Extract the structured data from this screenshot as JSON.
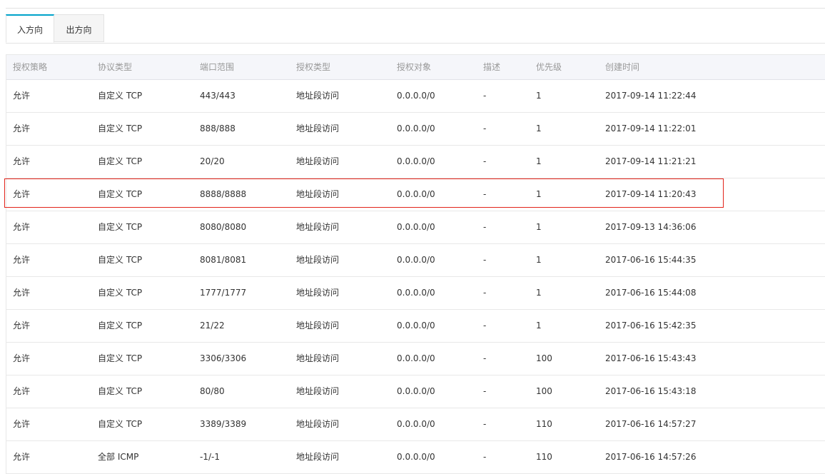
{
  "tabs": [
    {
      "label": "入方向",
      "active": true
    },
    {
      "label": "出方向",
      "active": false
    }
  ],
  "table": {
    "columns": [
      "授权策略",
      "协议类型",
      "端口范围",
      "授权类型",
      "授权对象",
      "描述",
      "优先级",
      "创建时间"
    ],
    "rows": [
      [
        "允许",
        "自定义 TCP",
        "443/443",
        "地址段访问",
        "0.0.0.0/0",
        "-",
        "1",
        "2017-09-14 11:22:44"
      ],
      [
        "允许",
        "自定义 TCP",
        "888/888",
        "地址段访问",
        "0.0.0.0/0",
        "-",
        "1",
        "2017-09-14 11:22:01"
      ],
      [
        "允许",
        "自定义 TCP",
        "20/20",
        "地址段访问",
        "0.0.0.0/0",
        "-",
        "1",
        "2017-09-14 11:21:21"
      ],
      [
        "允许",
        "自定义 TCP",
        "8888/8888",
        "地址段访问",
        "0.0.0.0/0",
        "-",
        "1",
        "2017-09-14 11:20:43"
      ],
      [
        "允许",
        "自定义 TCP",
        "8080/8080",
        "地址段访问",
        "0.0.0.0/0",
        "-",
        "1",
        "2017-09-13 14:36:06"
      ],
      [
        "允许",
        "自定义 TCP",
        "8081/8081",
        "地址段访问",
        "0.0.0.0/0",
        "-",
        "1",
        "2017-06-16 15:44:35"
      ],
      [
        "允许",
        "自定义 TCP",
        "1777/1777",
        "地址段访问",
        "0.0.0.0/0",
        "-",
        "1",
        "2017-06-16 15:44:08"
      ],
      [
        "允许",
        "自定义 TCP",
        "21/22",
        "地址段访问",
        "0.0.0.0/0",
        "-",
        "1",
        "2017-06-16 15:42:35"
      ],
      [
        "允许",
        "自定义 TCP",
        "3306/3306",
        "地址段访问",
        "0.0.0.0/0",
        "-",
        "100",
        "2017-06-16 15:43:43"
      ],
      [
        "允许",
        "自定义 TCP",
        "80/80",
        "地址段访问",
        "0.0.0.0/0",
        "-",
        "100",
        "2017-06-16 15:43:18"
      ],
      [
        "允许",
        "自定义 TCP",
        "3389/3389",
        "地址段访问",
        "0.0.0.0/0",
        "-",
        "110",
        "2017-06-16 14:57:27"
      ],
      [
        "允许",
        "全部 ICMP",
        "-1/-1",
        "地址段访问",
        "0.0.0.0/0",
        "-",
        "110",
        "2017-06-16 14:57:26"
      ]
    ],
    "highlighted_row": 3
  },
  "colors": {
    "tab_accent": "#00a2ca",
    "highlight_border": "#e2231a",
    "header_bg": "#f5f6fa"
  }
}
